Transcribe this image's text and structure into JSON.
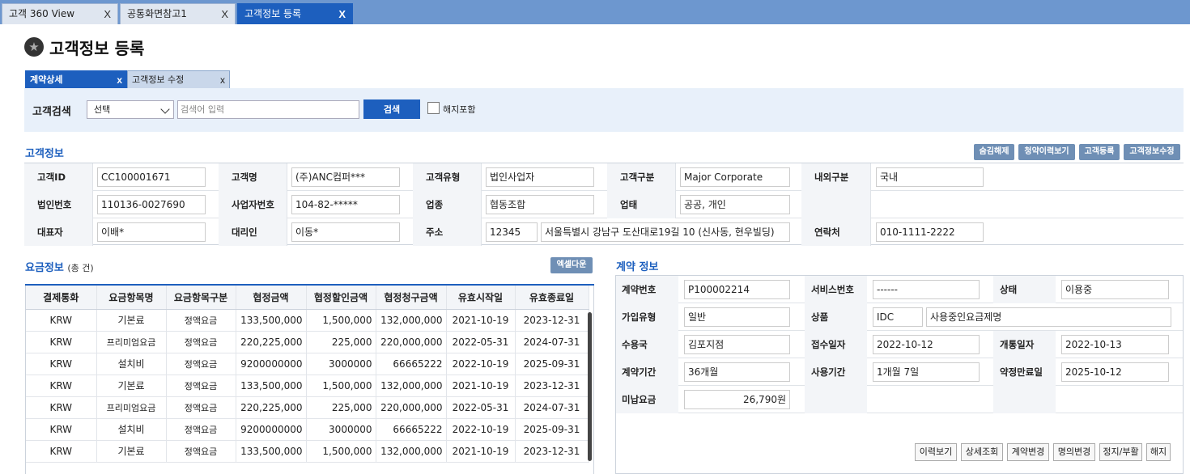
{
  "top_tabs": [
    {
      "label": "고객 360 View",
      "close": "X"
    },
    {
      "label": "공통화면참고1",
      "close": "X"
    },
    {
      "label": "고객정보 등록",
      "close": "X"
    }
  ],
  "page_title": "고객정보 등록",
  "sub_tabs": [
    {
      "label": "계약상세",
      "close": "x"
    },
    {
      "label": "고객정보 수정",
      "close": "x"
    }
  ],
  "search": {
    "label": "고객검색",
    "select_value": "선택",
    "placeholder": "검색어 입력",
    "button": "검색",
    "checkbox_label": "해지포함"
  },
  "customer": {
    "title": "고객정보",
    "buttons": [
      "숨김해제",
      "청약이력보기",
      "고객등록",
      "고객정보수정"
    ],
    "labels": {
      "id": "고객ID",
      "name": "고객명",
      "type": "고객유형",
      "category": "고객구분",
      "domestic": "내외구분",
      "corp_no": "법인번호",
      "biz_no": "사업자번호",
      "industry": "업종",
      "biz_type": "업태",
      "rep": "대표자",
      "agent": "대리인",
      "address": "주소",
      "contact": "연락처"
    },
    "values": {
      "id": "CC100001671",
      "name": "(주)ANC컴퍼***",
      "type": "법인사업자",
      "category": "Major Corporate",
      "domestic": "국내",
      "corp_no": "110136-0027690",
      "biz_no": "104-82-*****",
      "industry": "협동조합",
      "biz_type": "공공, 개인",
      "rep": "이배*",
      "agent": "이동*",
      "zip": "12345",
      "address": "서울특별시 강남구 도산대로19길 10 (신사동, 현우빌딩)",
      "contact": "010-1111-2222"
    }
  },
  "fee": {
    "title": "요금정보",
    "count_text": "(총 건)",
    "excel_button": "엑셀다운",
    "columns": [
      "결제통화",
      "요금항목명",
      "요금항목구분",
      "협정금액",
      "협정할인금액",
      "협정청구금액",
      "유효시작일",
      "유효종료일"
    ],
    "rows": [
      [
        "KRW",
        "기본료",
        "정액요금",
        "133,500,000",
        "1,500,000",
        "132,000,000",
        "2021-10-19",
        "2023-12-31"
      ],
      [
        "KRW",
        "프리미엄요금",
        "정액요금",
        "220,225,000",
        "225,000",
        "220,000,000",
        "2022-05-31",
        "2024-07-31"
      ],
      [
        "KRW",
        "설치비",
        "정액요금",
        "9200000000",
        "3000000",
        "66665222",
        "2022-10-19",
        "2025-09-31"
      ],
      [
        "KRW",
        "기본료",
        "정액요금",
        "133,500,000",
        "1,500,000",
        "132,000,000",
        "2021-10-19",
        "2023-12-31"
      ],
      [
        "KRW",
        "프리미엄요금",
        "정액요금",
        "220,225,000",
        "225,000",
        "220,000,000",
        "2022-05-31",
        "2024-07-31"
      ],
      [
        "KRW",
        "설치비",
        "정액요금",
        "9200000000",
        "3000000",
        "66665222",
        "2022-10-19",
        "2025-09-31"
      ],
      [
        "KRW",
        "기본료",
        "정액요금",
        "133,500,000",
        "1,500,000",
        "132,000,000",
        "2021-10-19",
        "2023-12-31"
      ]
    ]
  },
  "contract": {
    "title": "계약 정보",
    "labels": {
      "no": "계약번호",
      "service_no": "서비스번호",
      "status": "상태",
      "join_type": "가입유형",
      "product": "상품",
      "office": "수용국",
      "receipt_date": "접수일자",
      "open_date": "개통일자",
      "period": "계약기간",
      "usage": "사용기간",
      "expiry": "약정만료일",
      "unpaid": "미납요금"
    },
    "values": {
      "no": "P100002214",
      "service_no": "------",
      "status": "이용중",
      "join_type": "일반",
      "product_code": "IDC",
      "product_name": "사용중인요금제명",
      "office": "김포지점",
      "receipt_date": "2022-10-12",
      "open_date": "2022-10-13",
      "period": "36개월",
      "usage": "1개월 7일",
      "expiry": "2025-10-12",
      "unpaid": "26,790원"
    },
    "actions": [
      "이력보기",
      "상세조회",
      "계약변경",
      "명의변경",
      "정지/부활",
      "해지"
    ]
  }
}
